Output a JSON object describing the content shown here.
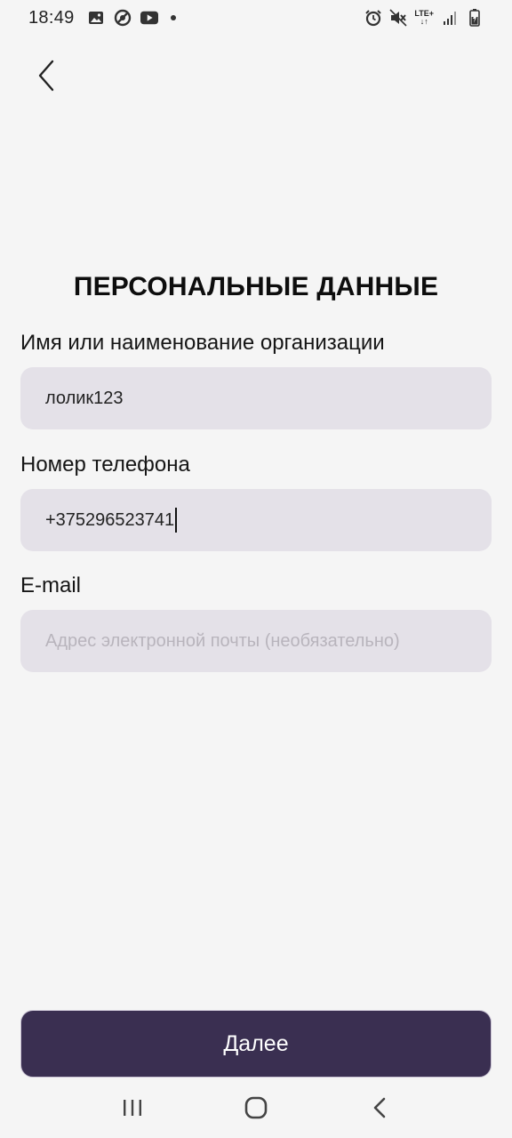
{
  "status_bar": {
    "time": "18:49",
    "network": "LTE+"
  },
  "header": {
    "back_icon": "chevron-left-icon"
  },
  "page": {
    "title": "ПЕРСОНАЛЬНЫЕ ДАННЫЕ"
  },
  "form": {
    "name": {
      "label": "Имя или наименование организации",
      "value": "лолик123"
    },
    "phone": {
      "label": "Номер телефона",
      "value": "+375296523741"
    },
    "email": {
      "label": "E-mail",
      "value": "",
      "placeholder": "Адрес электронной почты (необязательно)"
    }
  },
  "actions": {
    "next_label": "Далее"
  },
  "colors": {
    "background": "#f5f5f5",
    "field_bg": "#e4e1e8",
    "primary_button": "#3a2f51",
    "placeholder": "#b8b4bc"
  }
}
